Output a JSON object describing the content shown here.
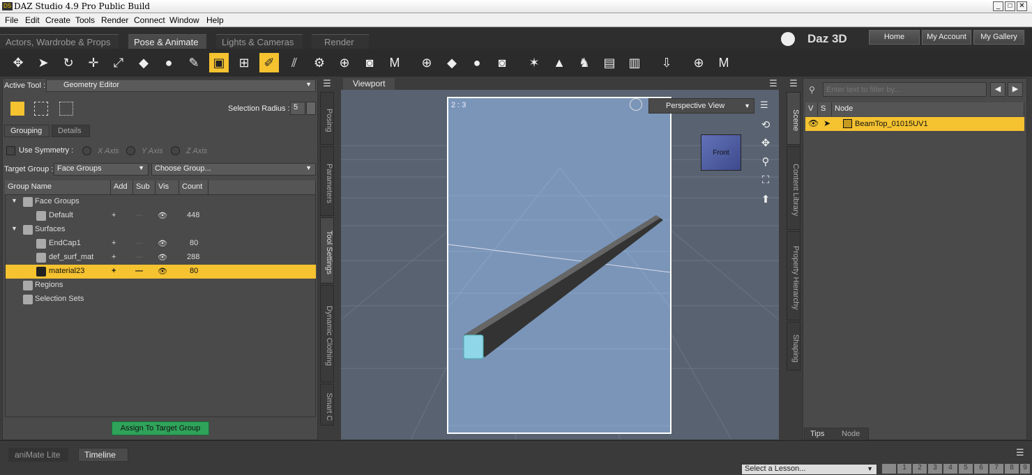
{
  "window": {
    "title": "DAZ Studio 4.9 Pro Public Build",
    "logo": "DS",
    "min": "_",
    "max": "□",
    "close": "✕"
  },
  "menu": [
    "File",
    "Edit",
    "Create",
    "Tools",
    "Render",
    "Connect",
    "Window",
    "Help"
  ],
  "rooms": [
    "Actors, Wardrobe & Props",
    "Pose & Animate",
    "Lights & Cameras",
    "Render"
  ],
  "brand": "Daz 3D",
  "header_buttons": [
    "Home",
    "My Account",
    "My Gallery"
  ],
  "tool_icons": [
    "universal-tool",
    "node-selection",
    "rotate",
    "translate",
    "scale",
    "surface-selector",
    "joint-editor",
    "geometry-editor-active",
    "region-navigator",
    "node-weight",
    "active-pose",
    "tool-11",
    "tool-12",
    "tool-13",
    "tool-14",
    "tool-15",
    "tool-16",
    "tool-17",
    "tool-18",
    "tool-19",
    "tool-20",
    "tool-21",
    "tool-22",
    "tool-23",
    "tool-24",
    "tool-25"
  ],
  "left": {
    "active_tool_label": "Active Tool :",
    "active_tool_value": "Geometry Editor",
    "selection_radius_label": "Selection Radius :",
    "selection_radius_value": "5",
    "tabs": [
      "Grouping",
      "Details"
    ],
    "use_symmetry": "Use Symmetry :",
    "axes": [
      "X Axis",
      "Y Axis",
      "Z Axis"
    ],
    "target_group_label": "Target Group :",
    "target_group_value": "Face Groups",
    "choose_group": "Choose Group...",
    "columns": [
      "Group Name",
      "Add",
      "Sub",
      "Vis",
      "Count"
    ],
    "rows": [
      {
        "name": "Face Groups",
        "indent": 0,
        "expand": "▼",
        "add": "",
        "sub": "",
        "vis": "",
        "count": ""
      },
      {
        "name": "Default",
        "indent": 1,
        "expand": "",
        "add": "+",
        "sub": "—",
        "vis": "👁",
        "count": "448"
      },
      {
        "name": "Surfaces",
        "indent": 0,
        "expand": "▼",
        "add": "",
        "sub": "",
        "vis": "",
        "count": ""
      },
      {
        "name": "EndCap1",
        "indent": 1,
        "expand": "",
        "add": "+",
        "sub": "—",
        "vis": "👁",
        "count": "80"
      },
      {
        "name": "def_surf_mat",
        "indent": 1,
        "expand": "",
        "add": "+",
        "sub": "—",
        "vis": "👁",
        "count": "288"
      },
      {
        "name": "material23",
        "indent": 1,
        "expand": "",
        "add": "+",
        "sub": "—",
        "vis": "👁",
        "count": "80",
        "selected": true
      },
      {
        "name": "Regions",
        "indent": 0,
        "expand": "",
        "add": "",
        "sub": "",
        "vis": "",
        "count": ""
      },
      {
        "name": "Selection Sets",
        "indent": 0,
        "expand": "",
        "add": "",
        "sub": "",
        "vis": "",
        "count": ""
      }
    ],
    "assign_button": "Assign To Target Group"
  },
  "side_tabs_left": [
    "Posing",
    "Parameters",
    "Tool Settings",
    "Dynamic Clothing",
    "Smart C"
  ],
  "viewport": {
    "tab": "Viewport",
    "aspect": "2 : 3",
    "view": "Perspective View",
    "cube_label": "Front"
  },
  "side_tabs_right": [
    "Scene",
    "Content Library",
    "Property Hierarchy",
    "Shaping"
  ],
  "right": {
    "filter_placeholder": "Enter text to filter by...",
    "columns": [
      "V",
      "S",
      "Node"
    ],
    "node": "BeamTop_01015UV1",
    "bottom_tabs": [
      "Tips",
      "Node"
    ]
  },
  "bottom": {
    "tabs": [
      "aniMate Lite",
      "Timeline"
    ],
    "lesson": "Select a Lesson...",
    "pages": [
      "1",
      "2",
      "3",
      "4",
      "5",
      "6",
      "7",
      "8",
      "9"
    ]
  },
  "colors": {
    "accent": "#f5c230",
    "dark": "#2b2b2b",
    "panel": "#4a4a4a",
    "assign": "#2fa35a"
  }
}
